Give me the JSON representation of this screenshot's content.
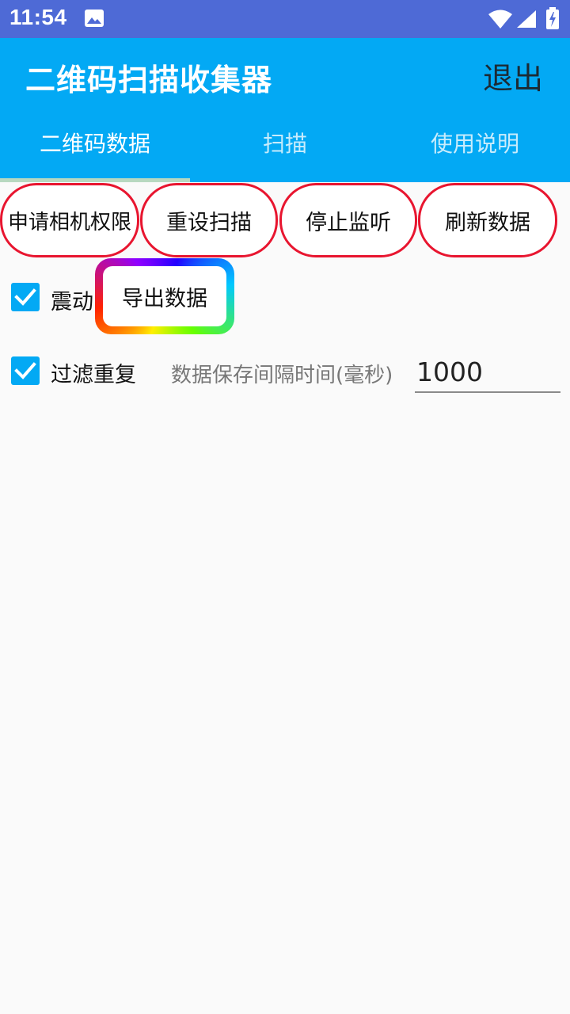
{
  "status_bar": {
    "time": "11:54",
    "icons": [
      "image-icon",
      "wifi-icon",
      "signal-icon",
      "battery-charging-icon"
    ],
    "color": "#4e6ad6"
  },
  "appbar": {
    "title": "二维码扫描收集器",
    "exit_label": "退出",
    "color": "#03a9f4"
  },
  "tabs": [
    {
      "label": "二维码数据",
      "active": true
    },
    {
      "label": "扫描",
      "active": false
    },
    {
      "label": "使用说明",
      "active": false
    }
  ],
  "actions": {
    "request_permission": "申请相机权限",
    "reset_scan": "重设扫描",
    "stop_listen": "停止监听",
    "refresh_data": "刷新数据",
    "border_color": "#e8152f"
  },
  "options": {
    "vibrate_label": "震动",
    "vibrate_checked": true,
    "export_label": "导出数据",
    "filter_label": "过滤重复",
    "filter_checked": true,
    "interval_label": "数据保存间隔时间(毫秒)",
    "interval_value": "1000"
  }
}
